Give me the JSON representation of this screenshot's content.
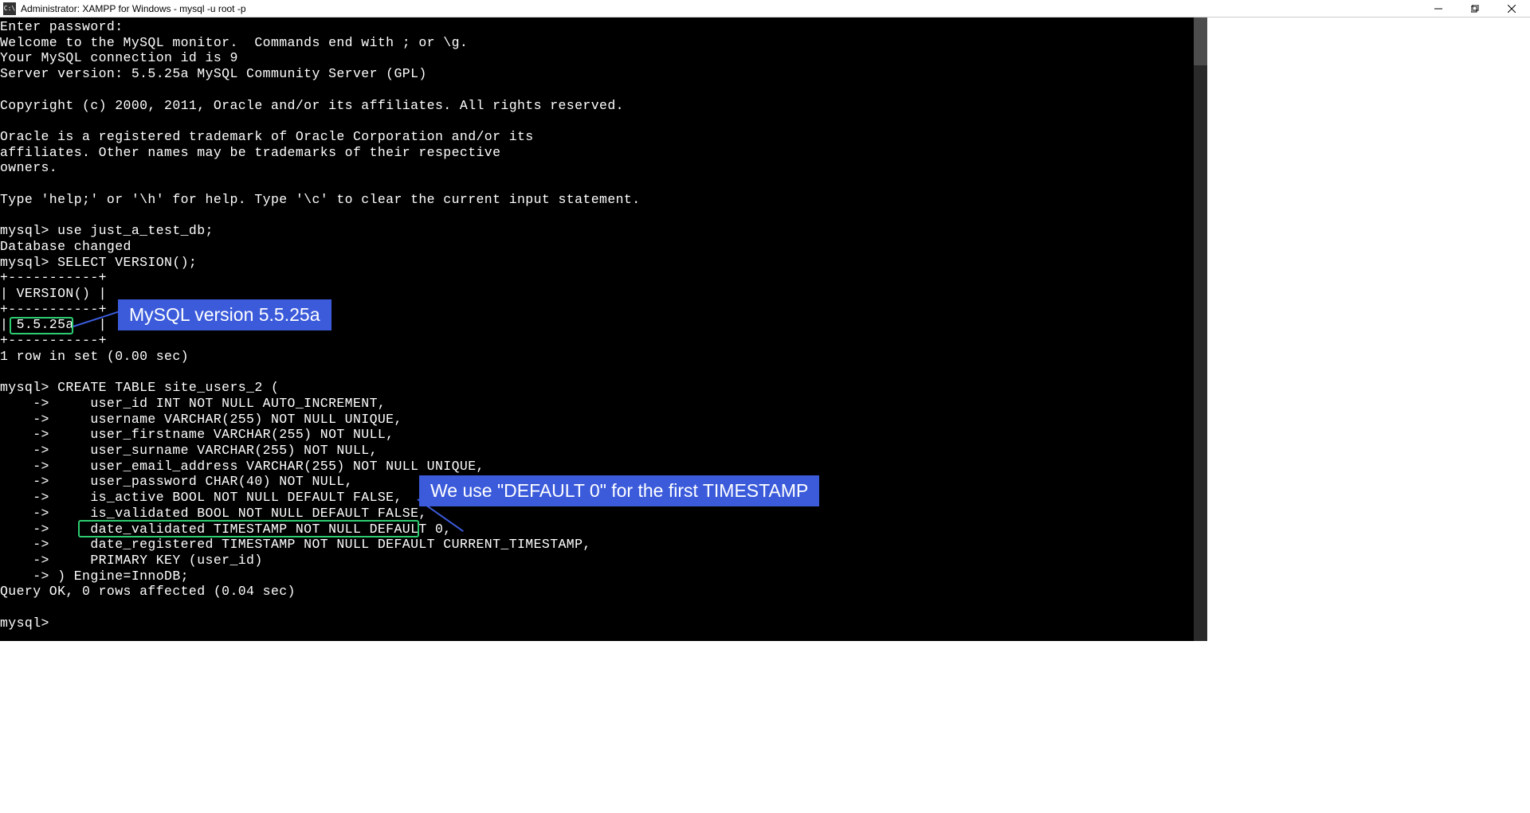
{
  "window": {
    "title": "Administrator:  XAMPP for Windows - mysql  -u root -p",
    "icon_label": "C:\\"
  },
  "terminal_lines": [
    "Enter password:",
    "Welcome to the MySQL monitor.  Commands end with ; or \\g.",
    "Your MySQL connection id is 9",
    "Server version: 5.5.25a MySQL Community Server (GPL)",
    "",
    "Copyright (c) 2000, 2011, Oracle and/or its affiliates. All rights reserved.",
    "",
    "Oracle is a registered trademark of Oracle Corporation and/or its",
    "affiliates. Other names may be trademarks of their respective",
    "owners.",
    "",
    "Type 'help;' or '\\h' for help. Type '\\c' to clear the current input statement.",
    "",
    "mysql> use just_a_test_db;",
    "Database changed",
    "mysql> SELECT VERSION();",
    "+-----------+",
    "| VERSION() |",
    "+-----------+",
    "| 5.5.25a   |",
    "+-----------+",
    "1 row in set (0.00 sec)",
    "",
    "mysql> CREATE TABLE site_users_2 (",
    "    ->     user_id INT NOT NULL AUTO_INCREMENT,",
    "    ->     username VARCHAR(255) NOT NULL UNIQUE,",
    "    ->     user_firstname VARCHAR(255) NOT NULL,",
    "    ->     user_surname VARCHAR(255) NOT NULL,",
    "    ->     user_email_address VARCHAR(255) NOT NULL UNIQUE,",
    "    ->     user_password CHAR(40) NOT NULL,",
    "    ->     is_active BOOL NOT NULL DEFAULT FALSE,",
    "    ->     is_validated BOOL NOT NULL DEFAULT FALSE,",
    "    ->     date_validated TIMESTAMP NOT NULL DEFAULT 0,",
    "    ->     date_registered TIMESTAMP NOT NULL DEFAULT CURRENT_TIMESTAMP,",
    "    ->     PRIMARY KEY (user_id)",
    "    -> ) Engine=InnoDB;",
    "Query OK, 0 rows affected (0.04 sec)",
    "",
    "mysql>"
  ],
  "callouts": {
    "version": "MySQL version 5.5.25a",
    "default0": "We use \"DEFAULT 0\" for the first TIMESTAMP"
  },
  "highlights": {
    "version_value": "5.5.25a",
    "default0_line": "date_validated TIMESTAMP NOT NULL DEFAULT 0,"
  }
}
